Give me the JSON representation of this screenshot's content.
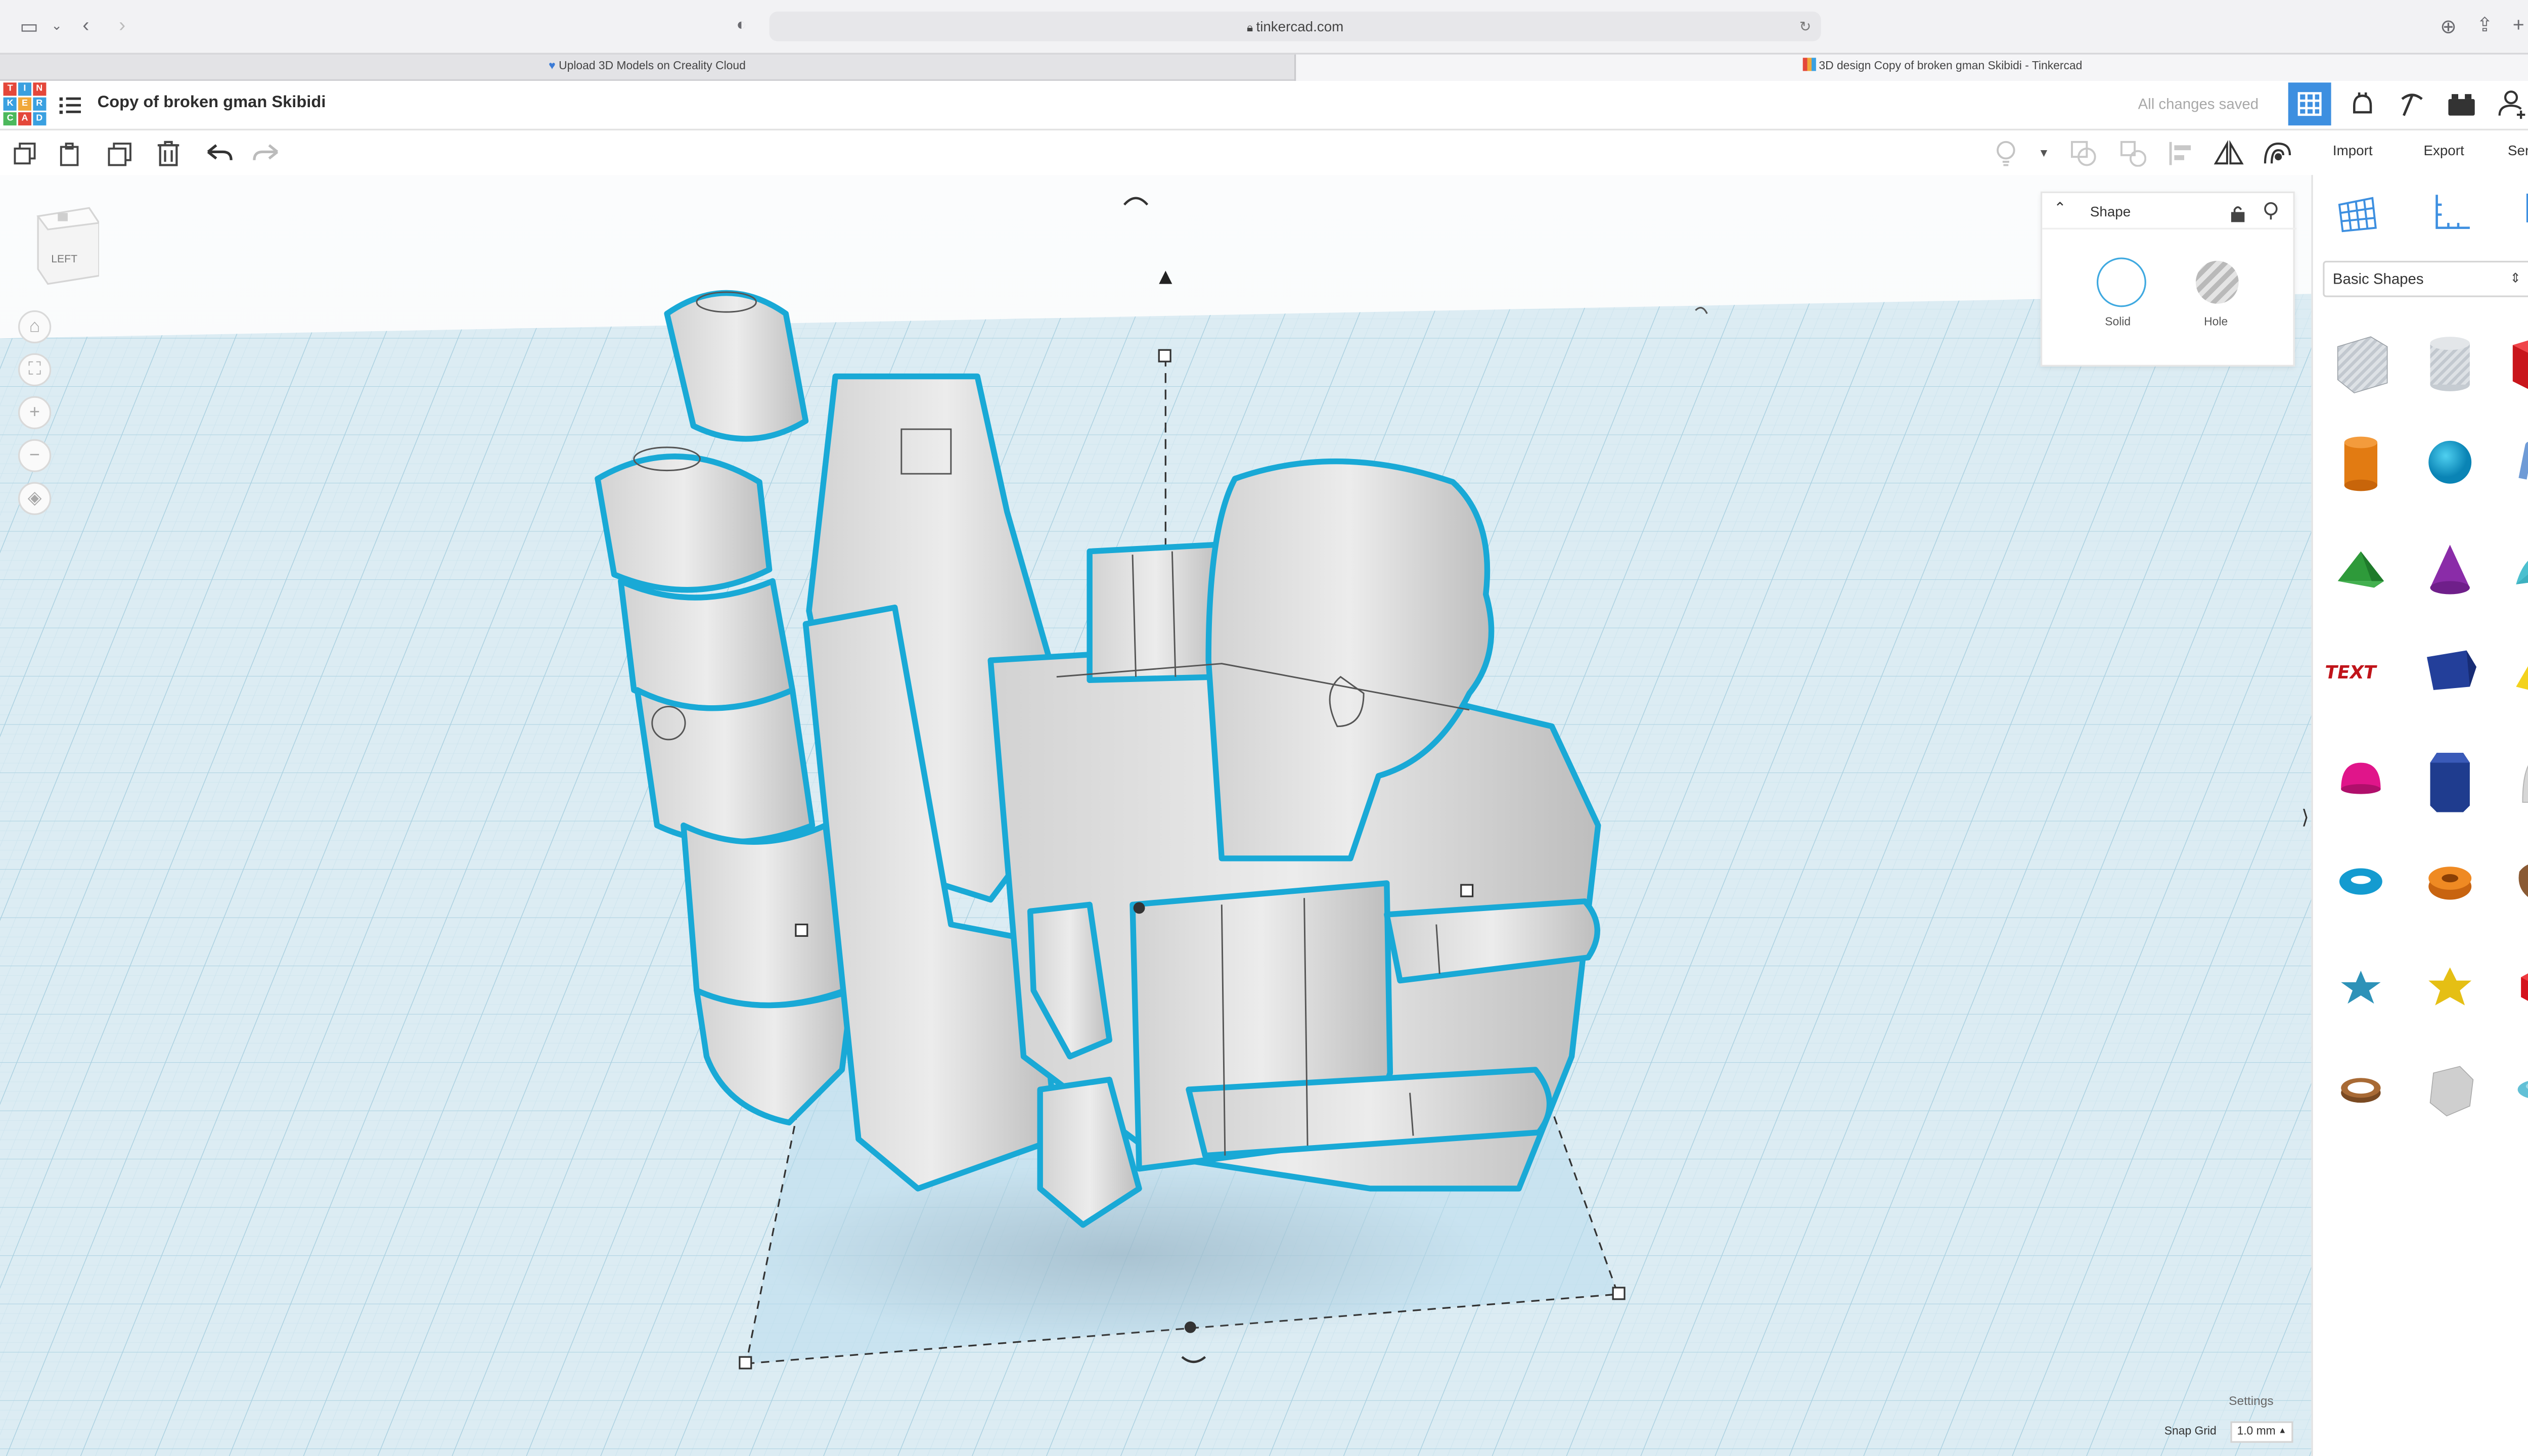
{
  "browser": {
    "url": "tinkercad.com",
    "tabs": [
      {
        "label": "Upload 3D Models on Creality Cloud",
        "active": false
      },
      {
        "label": "3D design Copy of broken gman Skibidi - Tinkercad",
        "active": true
      }
    ]
  },
  "app": {
    "logo_letters": [
      "TIN",
      "KER",
      "CAD"
    ],
    "design_title": "Copy of broken gman Skibidi",
    "save_status": "All changes saved"
  },
  "toolbar": {
    "import_label": "Import",
    "export_label": "Export",
    "send_to_label": "Send To"
  },
  "viewcube": {
    "face_label": "LEFT"
  },
  "shape_panel": {
    "title": "Shape",
    "solid_label": "Solid",
    "hole_label": "Hole"
  },
  "library": {
    "category": "Basic Shapes",
    "shapes": [
      "Box",
      "Cylinder",
      "Box",
      "Cylinder",
      "Sphere",
      "Scribble",
      "Roof",
      "Cone",
      "Round Roof",
      "Text",
      "Wedge",
      "Pyramid",
      "Half Sphere",
      "Polygon",
      "Paraboloid",
      "Torus",
      "Tube",
      "Shape Generator",
      "Star",
      "Star",
      "Icosahedron",
      "Ring",
      "Cylinder",
      "Ellipsoid"
    ]
  },
  "footer": {
    "settings_label": "Settings",
    "snap_grid_label": "Snap Grid",
    "snap_grid_value": "1.0 mm"
  },
  "colors": {
    "accent": "#3d8fe0",
    "selection_outline": "#19a9d6",
    "workplane": "#dcecf3",
    "grid_line": "#bcdce9"
  }
}
